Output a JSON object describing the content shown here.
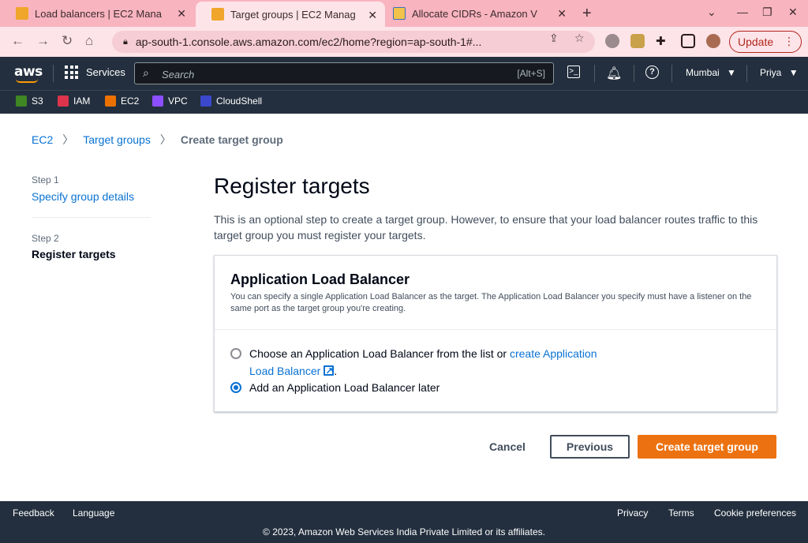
{
  "browser": {
    "tabs": [
      {
        "title": "Load balancers | EC2 Mana",
        "active": false,
        "favicon": "aws-cube-icon"
      },
      {
        "title": "Target groups | EC2 Manag",
        "active": true,
        "favicon": "aws-cube-icon"
      },
      {
        "title": "Allocate CIDRs - Amazon V",
        "active": false,
        "favicon": "docs-icon"
      }
    ],
    "url": "ap-south-1.console.aws.amazon.com/ec2/home?region=ap-south-1#...",
    "update_label": "Update"
  },
  "aws_header": {
    "logo_text": "aws",
    "services_label": "Services",
    "search_placeholder": "Search",
    "search_shortcut": "[Alt+S]",
    "region_label": "Mumbai",
    "user_label": "Priya"
  },
  "favorites": [
    {
      "label": "S3",
      "color": "#3f8624"
    },
    {
      "label": "IAM",
      "color": "#dd344c"
    },
    {
      "label": "EC2",
      "color": "#ed7100"
    },
    {
      "label": "VPC",
      "color": "#8c4fff"
    },
    {
      "label": "CloudShell",
      "color": "#3b48cc"
    }
  ],
  "breadcrumb": {
    "items": [
      "EC2",
      "Target groups"
    ],
    "current": "Create target group"
  },
  "steps": [
    {
      "step": "Step 1",
      "title": "Specify group details"
    },
    {
      "step": "Step 2",
      "title": "Register targets"
    }
  ],
  "main": {
    "title": "Register targets",
    "description": "This is an optional step to create a target group. However, to ensure that your load balancer routes traffic to this target group you must register your targets.",
    "panel": {
      "title": "Application Load Balancer",
      "description": "You can specify a single Application Load Balancer as the target. The Application Load Balancer you specify must have a listener on the same port as the target group you're creating.",
      "option1_text": "Choose an Application Load Balancer from the list or ",
      "option1_link": "create Application Load Balancer",
      "option2_text": "Add an Application Load Balancer later",
      "selected": "option2"
    }
  },
  "actions": {
    "cancel": "Cancel",
    "previous": "Previous",
    "create": "Create target group"
  },
  "footer": {
    "feedback": "Feedback",
    "language": "Language",
    "privacy": "Privacy",
    "terms": "Terms",
    "cookie": "Cookie preferences",
    "copyright": "© 2023, Amazon Web Services India Private Limited or its affiliates."
  }
}
